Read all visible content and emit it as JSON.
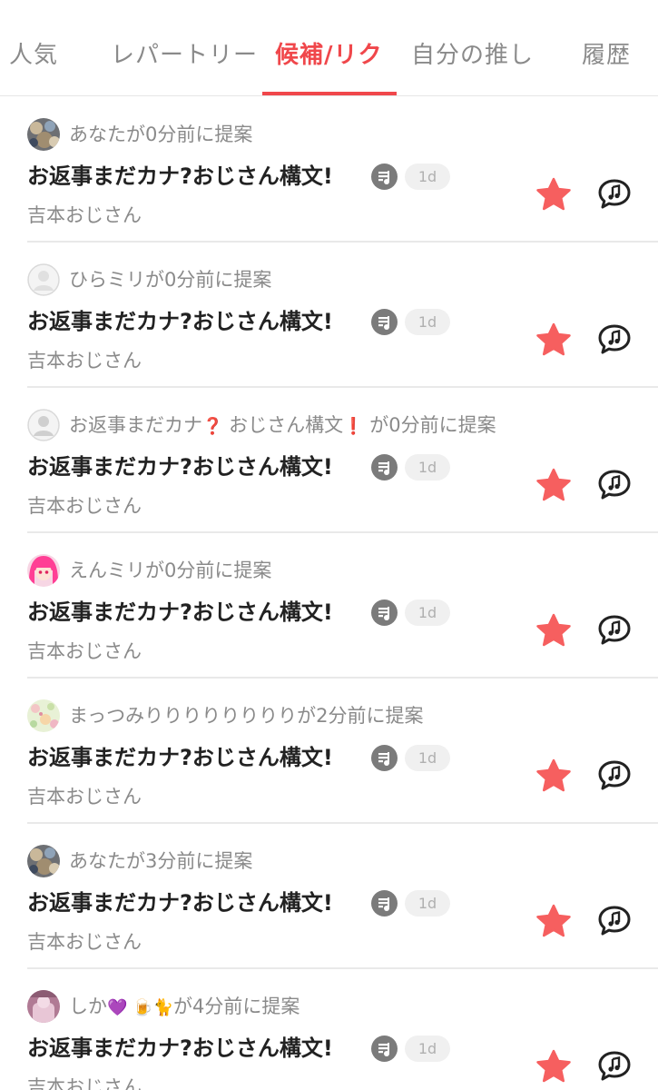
{
  "tabs": [
    {
      "label": "人気"
    },
    {
      "label": "レパートリー"
    },
    {
      "label": "候補/リク"
    },
    {
      "label": "自分の推し"
    },
    {
      "label": "履歴"
    }
  ],
  "active_tab": "候補/リク",
  "colors": {
    "accent": "#f0474b",
    "star": "#f65f5f",
    "muted_text": "#8a8a8a",
    "title_text": "#222222"
  },
  "requests": [
    {
      "suggestion": "あなたが0分前に提案",
      "title": "お返事まだカナ?おじさん構文!",
      "badge": "1d",
      "artist": "吉本おじさん",
      "avatar": "photo-avatar"
    },
    {
      "suggestion": "ひらミリが0分前に提案",
      "title": "お返事まだカナ?おじさん構文!",
      "badge": "1d",
      "artist": "吉本おじさん",
      "avatar": "default-avatar"
    },
    {
      "suggestion_parts": [
        "お返事まだカナ",
        "❓",
        " おじさん構文",
        "❗",
        " が0分前に提案"
      ],
      "title": "お返事まだカナ?おじさん構文!",
      "badge": "1d",
      "artist": "吉本おじさん",
      "avatar": "default-avatar"
    },
    {
      "suggestion": "えんミリが0分前に提案",
      "title": "お返事まだカナ?おじさん構文!",
      "badge": "1d",
      "artist": "吉本おじさん",
      "avatar": "anime-avatar"
    },
    {
      "suggestion": "まっつみりりりりりりりりが2分前に提案",
      "title": "お返事まだカナ?おじさん構文!",
      "badge": "1d",
      "artist": "吉本おじさん",
      "avatar": "floral-avatar"
    },
    {
      "suggestion": "あなたが3分前に提案",
      "title": "お返事まだカナ?おじさん構文!",
      "badge": "1d",
      "artist": "吉本おじさん",
      "avatar": "photo-avatar"
    },
    {
      "suggestion_parts": [
        "しか",
        "💜",
        " 🍺🐈",
        "が4分前に提案"
      ],
      "title": "お返事まだカナ?おじさん構文!",
      "badge": "1d",
      "artist": "吉本おじさん",
      "avatar": "pink-avatar"
    }
  ],
  "icons": {
    "badge": "music-note-badge-icon",
    "favorite": "star-icon",
    "sing": "music-speech-bubble-icon"
  }
}
